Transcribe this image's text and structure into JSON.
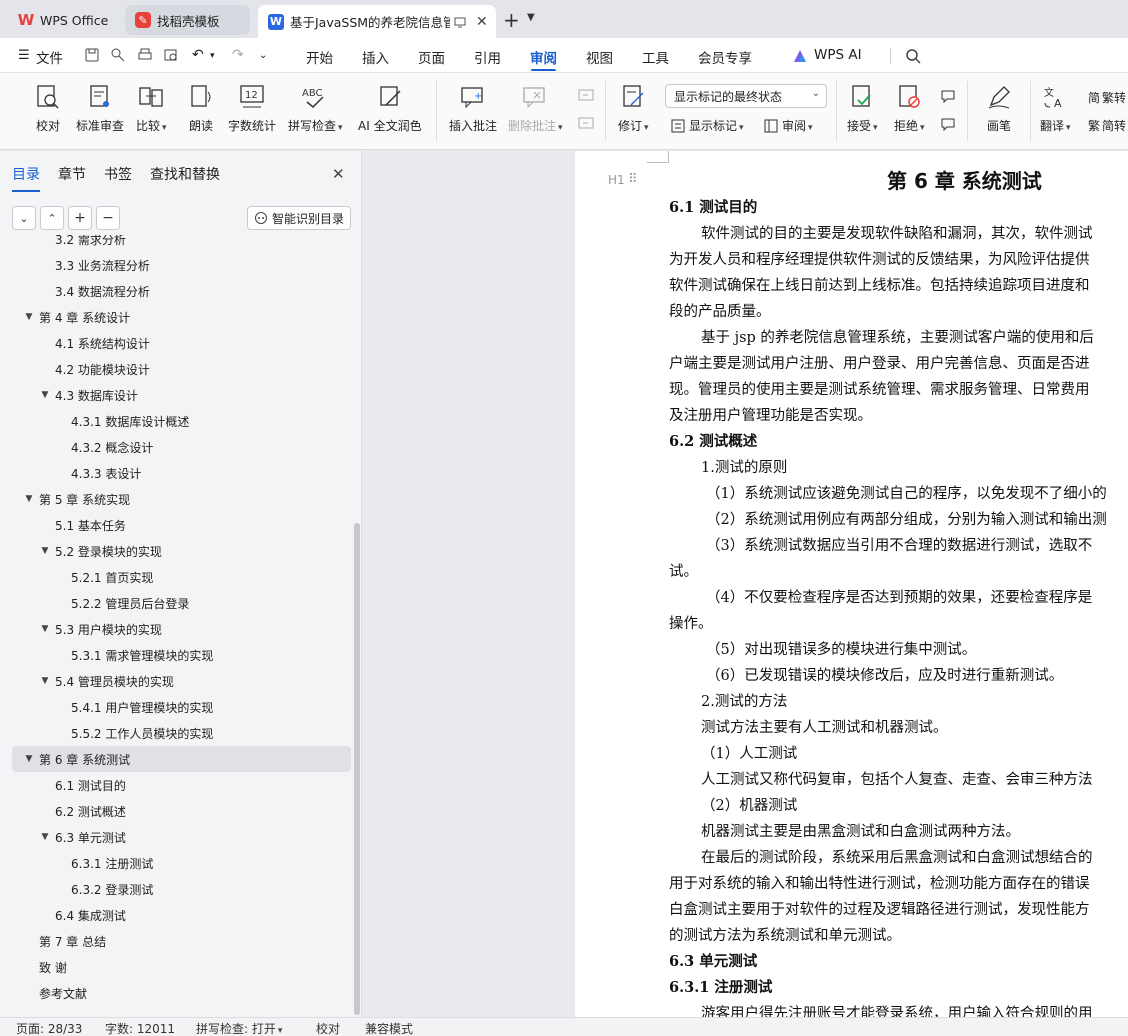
{
  "tabs": {
    "wps_office": "WPS Office",
    "template": "找稻壳模板",
    "document": "基于JavaSSM的养老院信息管"
  },
  "menu": {
    "file": "文件",
    "items": [
      "开始",
      "插入",
      "页面",
      "引用",
      "审阅",
      "视图",
      "工具",
      "会员专享"
    ],
    "selected": "审阅",
    "wps_ai": "WPS AI"
  },
  "ribbon": {
    "proofread": "校对",
    "standard_review": "标准审查",
    "compare": "比较",
    "read_aloud": "朗读",
    "word_count": "字数统计",
    "spell_check": "拼写检查",
    "ai_polish": "AI 全文润色",
    "insert_comment": "插入批注",
    "delete_comment": "删除批注",
    "revise": "修订",
    "markup_mode": "显示标记的最终状态",
    "show_markup": "显示标记",
    "review_pane": "审阅",
    "accept": "接受",
    "reject": "拒绝",
    "pen": "画笔",
    "translate": "翻译",
    "convert_simp": "繁转",
    "convert_trad": "简转"
  },
  "nav": {
    "tabs": [
      "目录",
      "章节",
      "书签",
      "查找和替换"
    ],
    "smart_toc": "智能识别目录",
    "items": [
      {
        "label": "3.2 需求分析",
        "level": 1,
        "arrow": ""
      },
      {
        "label": "3.3 业务流程分析",
        "level": 1,
        "arrow": ""
      },
      {
        "label": "3.4 数据流程分析",
        "level": 1,
        "arrow": ""
      },
      {
        "label": "第 4 章  系统设计",
        "level": 0,
        "arrow": "▼"
      },
      {
        "label": "4.1 系统结构设计",
        "level": 1,
        "arrow": ""
      },
      {
        "label": "4.2 功能模块设计",
        "level": 1,
        "arrow": ""
      },
      {
        "label": "4.3 数据库设计",
        "level": 1,
        "arrow": "▼"
      },
      {
        "label": "4.3.1 数据库设计概述",
        "level": 2,
        "arrow": ""
      },
      {
        "label": "4.3.2 概念设计",
        "level": 2,
        "arrow": ""
      },
      {
        "label": "4.3.3 表设计",
        "level": 2,
        "arrow": ""
      },
      {
        "label": "第 5 章   系统实现",
        "level": 0,
        "arrow": "▼"
      },
      {
        "label": "5.1 基本任务",
        "level": 1,
        "arrow": ""
      },
      {
        "label": "5.2 登录模块的实现",
        "level": 1,
        "arrow": "▼"
      },
      {
        "label": "5.2.1 首页实现",
        "level": 2,
        "arrow": ""
      },
      {
        "label": "5.2.2 管理员后台登录",
        "level": 2,
        "arrow": ""
      },
      {
        "label": "5.3 用户模块的实现",
        "level": 1,
        "arrow": "▼"
      },
      {
        "label": "5.3.1 需求管理模块的实现",
        "level": 2,
        "arrow": ""
      },
      {
        "label": "5.4 管理员模块的实现",
        "level": 1,
        "arrow": "▼"
      },
      {
        "label": "5.4.1 用户管理模块的实现",
        "level": 2,
        "arrow": ""
      },
      {
        "label": "5.5.2 工作人员模块的实现",
        "level": 2,
        "arrow": ""
      },
      {
        "label": "第 6 章   系统测试",
        "level": 0,
        "arrow": "▼"
      },
      {
        "label": "6.1 测试目的",
        "level": 1,
        "arrow": ""
      },
      {
        "label": "6.2 测试概述",
        "level": 1,
        "arrow": ""
      },
      {
        "label": "6.3 单元测试",
        "level": 1,
        "arrow": "▼"
      },
      {
        "label": "6.3.1 注册测试",
        "level": 2,
        "arrow": ""
      },
      {
        "label": "6.3.2 登录测试",
        "level": 2,
        "arrow": ""
      },
      {
        "label": "6.4 集成测试",
        "level": 1,
        "arrow": ""
      },
      {
        "label": "第 7 章   总结",
        "level": 0,
        "arrow": ""
      },
      {
        "label": "致   谢",
        "level": 0,
        "arrow": ""
      },
      {
        "label": "参考文献",
        "level": 0,
        "arrow": ""
      }
    ]
  },
  "doc": {
    "chapter_title": "第 6 章   系统测试",
    "lines": [
      {
        "t": "6.1 测试目的",
        "s": "h"
      },
      {
        "t": "软件测试的目的主要是发现软件缺陷和漏洞，其次，软件测试",
        "s": "ind"
      },
      {
        "t": "为开发人员和程序经理提供软件测试的反馈结果，为风险评估提供",
        "s": ""
      },
      {
        "t": "软件测试确保在上线日前达到上线标准。包括持续追踪项目进度和",
        "s": ""
      },
      {
        "t": "段的产品质量。",
        "s": ""
      },
      {
        "t": "基于 jsp 的养老院信息管理系统，主要测试客户端的使用和后",
        "s": "ind"
      },
      {
        "t": "户端主要是测试用户注册、用户登录、用户完善信息、页面是否进",
        "s": ""
      },
      {
        "t": "现。管理员的使用主要是测试系统管理、需求服务管理、日常费用",
        "s": ""
      },
      {
        "t": "及注册用户管理功能是否实现。",
        "s": ""
      },
      {
        "t": "6.2 测试概述",
        "s": "h"
      },
      {
        "t": "1.测试的原则",
        "s": "ind"
      },
      {
        "t": "（1）系统测试应该避免测试自己的程序，以免发现不了细小的",
        "s": "ind2"
      },
      {
        "t": "（2）系统测试用例应有两部分组成，分别为输入测试和输出测",
        "s": "ind2"
      },
      {
        "t": "（3）系统测试数据应当引用不合理的数据进行测试，选取不",
        "s": "ind2"
      },
      {
        "t": "试。",
        "s": ""
      },
      {
        "t": "（4）不仅要检查程序是否达到预期的效果，还要检查程序是",
        "s": "ind2"
      },
      {
        "t": "操作。",
        "s": ""
      },
      {
        "t": "（5）对出现错误多的模块进行集中测试。",
        "s": "ind2"
      },
      {
        "t": "（6）已发现错误的模块修改后，应及时进行重新测试。",
        "s": "ind2"
      },
      {
        "t": "2.测试的方法",
        "s": "ind"
      },
      {
        "t": "测试方法主要有人工测试和机器测试。",
        "s": "ind"
      },
      {
        "t": "（1）人工测试",
        "s": "ind"
      },
      {
        "t": "人工测试又称代码复审，包括个人复查、走查、会审三种方法",
        "s": "ind"
      },
      {
        "t": "（2）机器测试",
        "s": "ind"
      },
      {
        "t": "机器测试主要是由黑盒测试和白盒测试两种方法。",
        "s": "ind"
      },
      {
        "t": "在最后的测试阶段，系统采用后黑盒测试和白盒测试想结合的",
        "s": "ind"
      },
      {
        "t": "用于对系统的输入和输出特性进行测试，检测功能方面存在的错误",
        "s": ""
      },
      {
        "t": "白盒测试主要用于对软件的过程及逻辑路径进行测试，发现性能方",
        "s": ""
      },
      {
        "t": "的测试方法为系统测试和单元测试。",
        "s": ""
      },
      {
        "t": "6.3 单元测试",
        "s": "h"
      },
      {
        "t": "6.3.1 注册测试",
        "s": "h"
      },
      {
        "t": "游客用户得先注册账号才能登录系统，用户输入符合规则的用",
        "s": "ind"
      }
    ]
  },
  "status": {
    "page": "页面: 28/33",
    "words": "字数: 12011",
    "spell": "拼写检查: 打开",
    "proof": "校对",
    "compat": "兼容模式"
  },
  "colors": {
    "accent": "#1a5fd1",
    "wps_red": "#e8403a"
  }
}
